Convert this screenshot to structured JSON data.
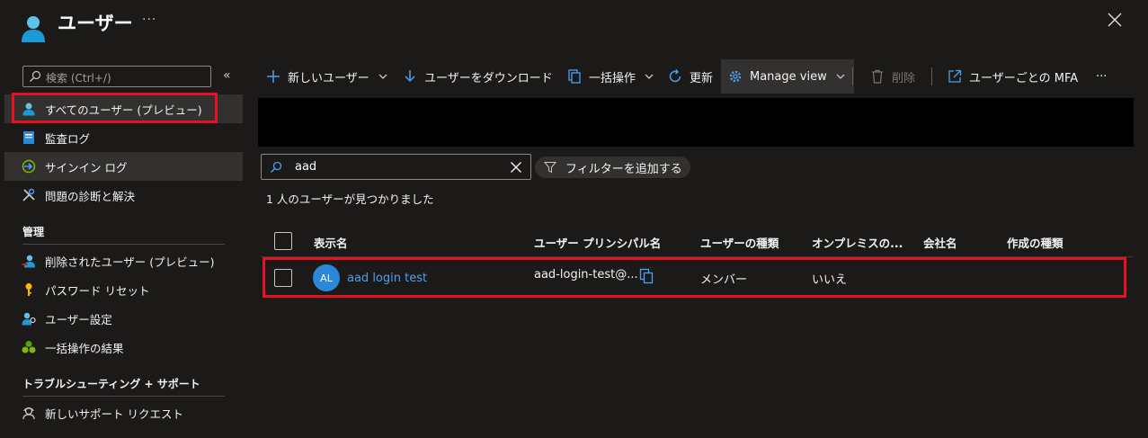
{
  "header": {
    "title": "ユーザー",
    "more": "···"
  },
  "sidebar": {
    "search_placeholder": "検索 (Ctrl+/)",
    "collapse": "«",
    "items": [
      {
        "label": "すべてのユーザー (プレビュー)",
        "icon": "user-icon"
      },
      {
        "label": "監査ログ",
        "icon": "audit-log-icon"
      },
      {
        "label": "サインイン ログ",
        "icon": "sign-in-log-icon"
      },
      {
        "label": "問題の診断と解決",
        "icon": "wrench-icon"
      }
    ],
    "section_manage": "管理",
    "manage_items": [
      {
        "label": "削除されたユーザー (プレビュー)",
        "icon": "deleted-user-icon"
      },
      {
        "label": "パスワード リセット",
        "icon": "key-icon"
      },
      {
        "label": "ユーザー設定",
        "icon": "user-settings-icon"
      },
      {
        "label": "一括操作の結果",
        "icon": "bulk-results-icon"
      }
    ],
    "section_support": "トラブルシューティング + サポート",
    "support_items": [
      {
        "label": "新しいサポート リクエスト",
        "icon": "support-icon"
      }
    ]
  },
  "toolbar": {
    "new_user": "新しいユーザー",
    "download_users": "ユーザーをダウンロード",
    "bulk_ops": "一括操作",
    "refresh": "更新",
    "manage_view": "Manage view",
    "delete": "削除",
    "per_user_mfa": "ユーザーごとの MFA",
    "more": "···"
  },
  "filter": {
    "search_value": "aad",
    "add_filter": "フィルターを追加する"
  },
  "result_count": "1 人のユーザーが見つかりました",
  "table": {
    "columns": [
      "表示名",
      "ユーザー プリンシパル名",
      "ユーザーの種類",
      "オンプレミスの...",
      "会社名",
      "作成の種類"
    ],
    "rows": [
      {
        "initials": "AL",
        "display_name": "aad login test",
        "upn": "aad-login-test@...",
        "user_type": "メンバー",
        "on_prem": "いいえ",
        "company": "",
        "creation_type": ""
      }
    ]
  },
  "colors": {
    "background": "#1b1a19",
    "accent": "#4aa0ef",
    "highlight": "#e81123",
    "avatar": "#2b88d8"
  }
}
